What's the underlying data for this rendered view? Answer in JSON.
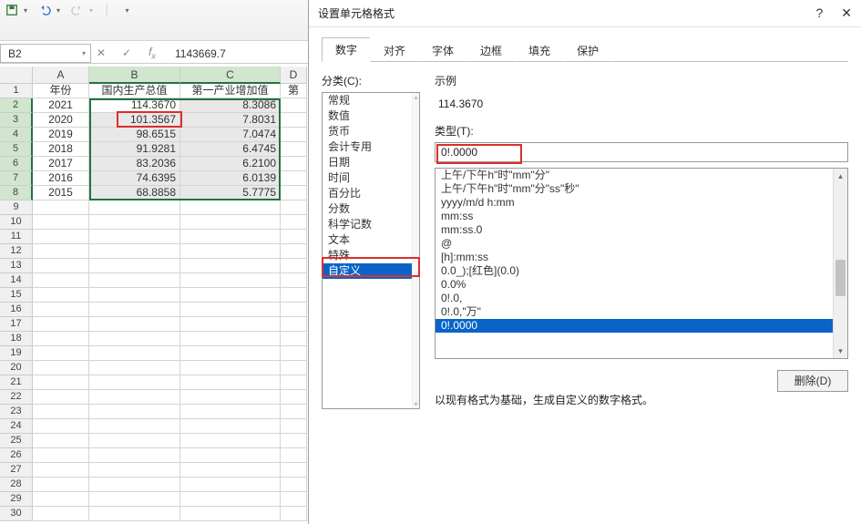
{
  "namebox": "B2",
  "formula": "1143669.7",
  "colHeaders": [
    "A",
    "B",
    "C",
    "D"
  ],
  "rowHeaders": [
    "1",
    "2",
    "3",
    "4",
    "5",
    "6",
    "7",
    "8",
    "9",
    "10",
    "11",
    "12",
    "13",
    "14",
    "15",
    "16",
    "17",
    "18",
    "19",
    "20",
    "21",
    "22",
    "23",
    "24",
    "25",
    "26",
    "27",
    "28",
    "29",
    "30"
  ],
  "sheetHeader": {
    "a": "年份",
    "b": "国内生产总值",
    "c": "第一产业增加值",
    "d": "第"
  },
  "rows": [
    {
      "a": "2021",
      "b": "114.3670",
      "c": "8.3086"
    },
    {
      "a": "2020",
      "b": "101.3567",
      "c": "7.8031"
    },
    {
      "a": "2019",
      "b": "98.6515",
      "c": "7.0474"
    },
    {
      "a": "2018",
      "b": "91.9281",
      "c": "6.4745"
    },
    {
      "a": "2017",
      "b": "83.2036",
      "c": "6.2100"
    },
    {
      "a": "2016",
      "b": "74.6395",
      "c": "6.0139"
    },
    {
      "a": "2015",
      "b": "68.8858",
      "c": "5.7775"
    }
  ],
  "dialog": {
    "title": "设置单元格格式",
    "help": "?",
    "close": "✕",
    "tabs": [
      "数字",
      "对齐",
      "字体",
      "边框",
      "填充",
      "保护"
    ],
    "activeTab": 0,
    "categoryLabel": "分类(C):",
    "categories": [
      "常规",
      "数值",
      "货币",
      "会计专用",
      "日期",
      "时间",
      "百分比",
      "分数",
      "科学记数",
      "文本",
      "特殊",
      "自定义"
    ],
    "categorySelected": 11,
    "exampleLabel": "示例",
    "exampleValue": "114.3670",
    "typeLabel": "类型(T):",
    "typeValue": "0!.0000",
    "formats": [
      "上午/下午h\"时\"mm\"分\"",
      "上午/下午h\"时\"mm\"分\"ss\"秒\"",
      "yyyy/m/d h:mm",
      "mm:ss",
      "mm:ss.0",
      "@",
      "[h]:mm:ss",
      "0.0_);[红色](0.0)",
      "0.0%",
      "0!.0,",
      "0!.0,\"万\"",
      "0!.0000"
    ],
    "formatSelected": 11,
    "deleteLabel": "删除(D)",
    "hint": "以现有格式为基础，生成自定义的数字格式。"
  }
}
